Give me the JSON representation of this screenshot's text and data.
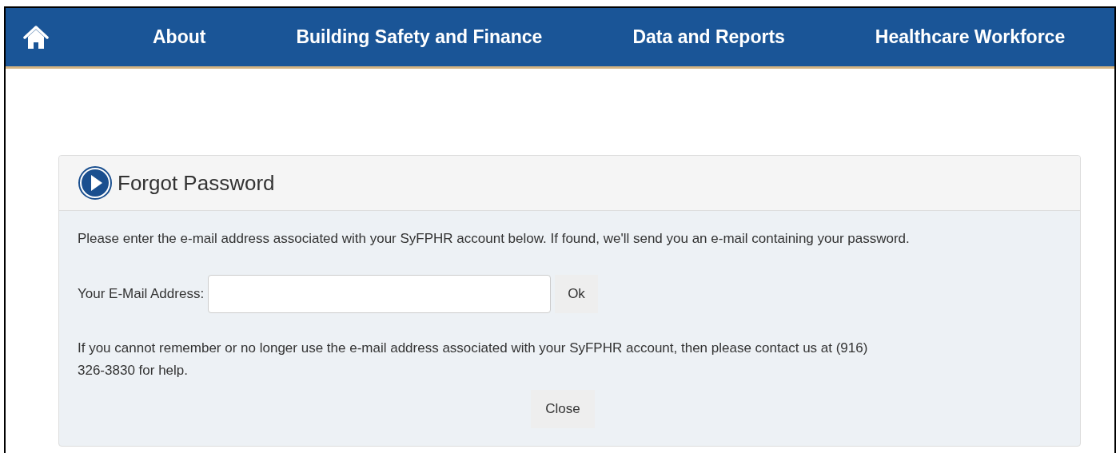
{
  "nav": {
    "items": [
      {
        "label": "About"
      },
      {
        "label": "Building Safety and Finance"
      },
      {
        "label": "Data and Reports"
      },
      {
        "label": "Healthcare Workforce"
      }
    ]
  },
  "panel": {
    "title": "Forgot Password",
    "instructions": "Please enter the e-mail address associated with your SyFPHR account below. If found, we'll send you an e-mail containing your password.",
    "email_label": "Your E-Mail Address:",
    "ok_button": "Ok",
    "help_text": "If you cannot remember or no longer use the e-mail address associated with your SyFPHR account, then please contact us at (916) 326-3830 for help.",
    "close_button": "Close"
  }
}
